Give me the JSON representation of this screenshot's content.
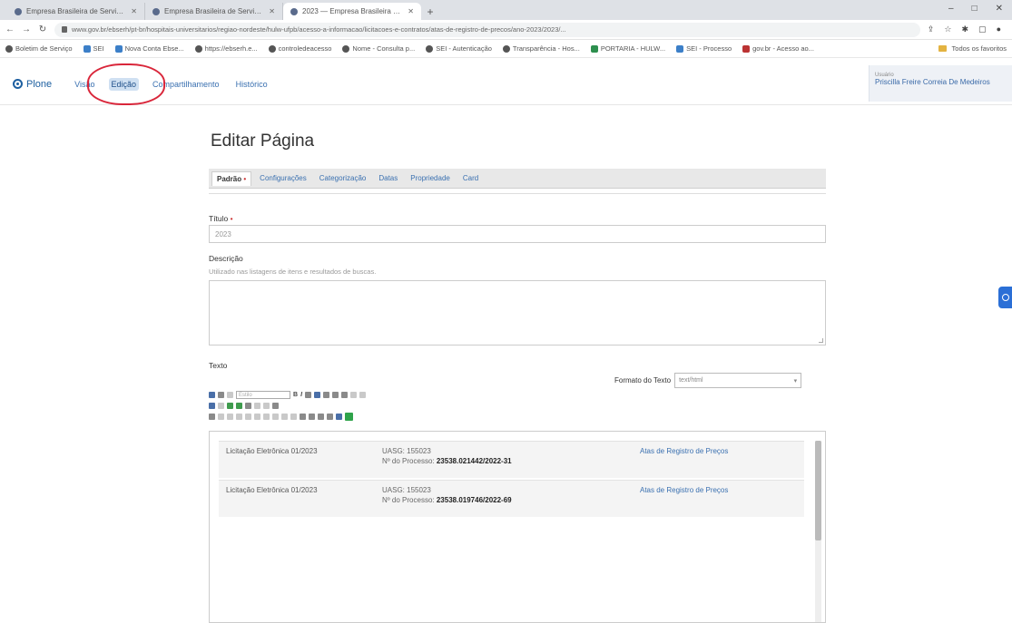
{
  "browser": {
    "tabs": [
      {
        "label": "Empresa Brasileira de Serviços H..."
      },
      {
        "label": "Empresa Brasileira de Serviços H..."
      },
      {
        "label": "2023 — Empresa Brasileira de S..."
      }
    ],
    "new_tab": "+",
    "window_controls": [
      "–",
      "□",
      "✕"
    ],
    "nav": {
      "back": "←",
      "forward": "→",
      "reload": "↻"
    },
    "url": "www.gov.br/ebserh/pt-br/hospitais-universitarios/regiao-nordeste/hulw-ufpb/acesso-a-informacao/licitacoes-e-contratos/atas-de-registro-de-precos/ano-2023/2023/...",
    "bookmarks": [
      "Boletim de Serviço",
      "SEI",
      "Nova Conta Ebse...",
      "https://ebserh.e...",
      "controledeacesso",
      "Nome - Consulta p...",
      "SEI - Autenticação",
      "Transparência - Hos...",
      "PORTARIA - HULW...",
      "SEI - Processo",
      "gov.br - Acesso ao..."
    ],
    "bookmarks_folder": "Todos os favoritos"
  },
  "plone": {
    "logo": "Plone",
    "menu": [
      "Visão",
      "Edição",
      "Compartilhamento",
      "Histórico"
    ],
    "active_menu_index": 1,
    "user_label": "Usuário",
    "user_name": "Priscilla Freire Correia De Medeiros"
  },
  "page": {
    "title": "Editar Página",
    "tabs": [
      "Padrão",
      "Configurações",
      "Categorização",
      "Datas",
      "Propriedade",
      "Card"
    ],
    "selected_tab": "Padrão",
    "fields": {
      "title_label": "Título",
      "title_value": "2023",
      "description_label": "Descrição",
      "description_help": "Utilizado nas listagens de itens e resultados de buscas.",
      "text_label": "Texto",
      "format_label": "Formato do Texto",
      "format_value": "text/html"
    },
    "editor": {
      "style_placeholder": "Estilo"
    },
    "rows": [
      {
        "col1": "Licitação Eletrônica 01/2023",
        "uasg": "UASG: 155023",
        "process_label": "Nº do Processo:",
        "process_number": "23538.021442/2022-31",
        "link": "Atas de Registro de Preços"
      },
      {
        "col1": "Licitação Eletrônica 01/2023",
        "uasg": "UASG: 155023",
        "process_label": "Nº do Processo:",
        "process_number": "23538.019746/2022-69",
        "link": "Atas de Registro de Preços"
      }
    ]
  },
  "colors": {
    "accent": "#1d5fa0",
    "highlight_circle": "#d9263a",
    "link": "#3a70b0"
  }
}
